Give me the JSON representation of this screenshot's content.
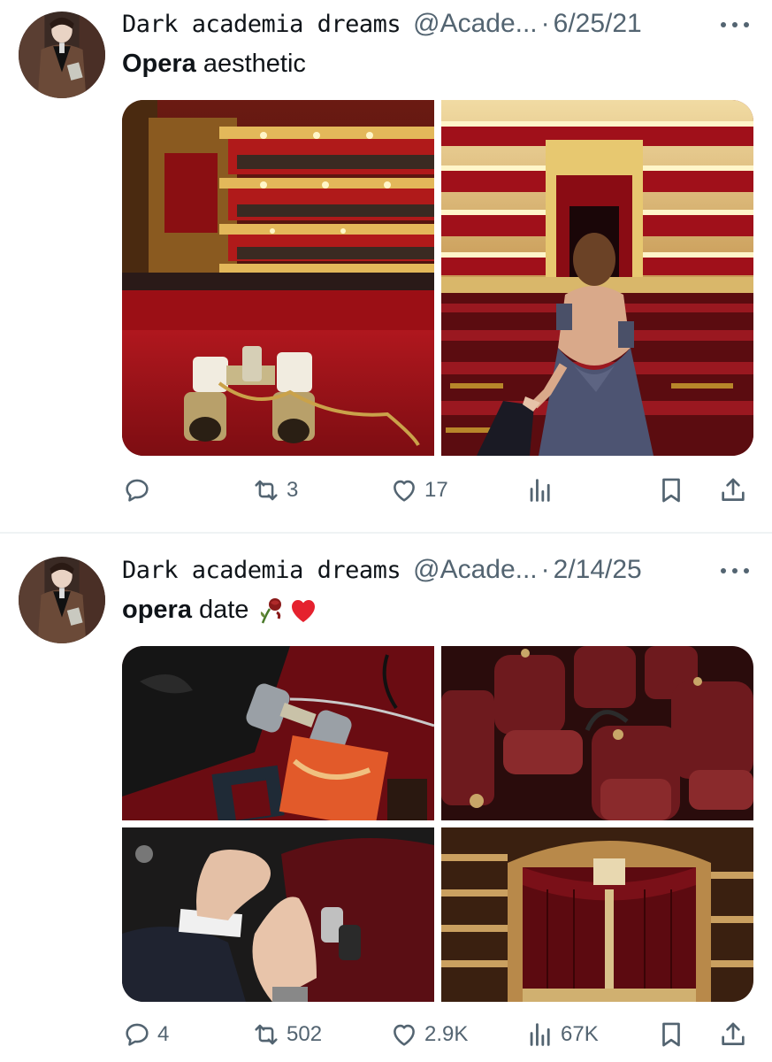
{
  "tweets": [
    {
      "author_name": "Dark academia dreams",
      "handle": "@Acade...",
      "separator": "·",
      "date": "6/25/21",
      "text_bold": "Opera",
      "text_rest": "aesthetic",
      "emojis": [],
      "images": [
        {
          "alt": "opera binoculars on red velvet balcony"
        },
        {
          "alt": "woman in gown leading hand through opera hall"
        }
      ],
      "actions": {
        "replies": "",
        "retweets": "3",
        "likes": "17",
        "views": ""
      }
    },
    {
      "author_name": "Dark academia dreams",
      "handle": "@Acade...",
      "separator": "·",
      "date": "2/14/25",
      "text_bold": "opera",
      "text_rest": "date",
      "emojis": [
        "wilted-rose-emoji",
        "red-heart-emoji"
      ],
      "images": [
        {
          "alt": "opera glasses, black purse and tickets"
        },
        {
          "alt": "red velvet theatre chairs"
        },
        {
          "alt": "holding hands with rings and opera glasses"
        },
        {
          "alt": "opera house stage with red curtain"
        }
      ],
      "actions": {
        "replies": "4",
        "retweets": "502",
        "likes": "2.9K",
        "views": "67K"
      }
    }
  ],
  "icons": {
    "reply": "reply-icon",
    "retweet": "retweet-icon",
    "like": "heart-icon",
    "views": "views-icon",
    "bookmark": "bookmark-icon",
    "share": "share-icon",
    "more": "more-icon"
  },
  "colors": {
    "muted": "#536471",
    "text": "#0f1419",
    "divider": "#eff3f4"
  }
}
